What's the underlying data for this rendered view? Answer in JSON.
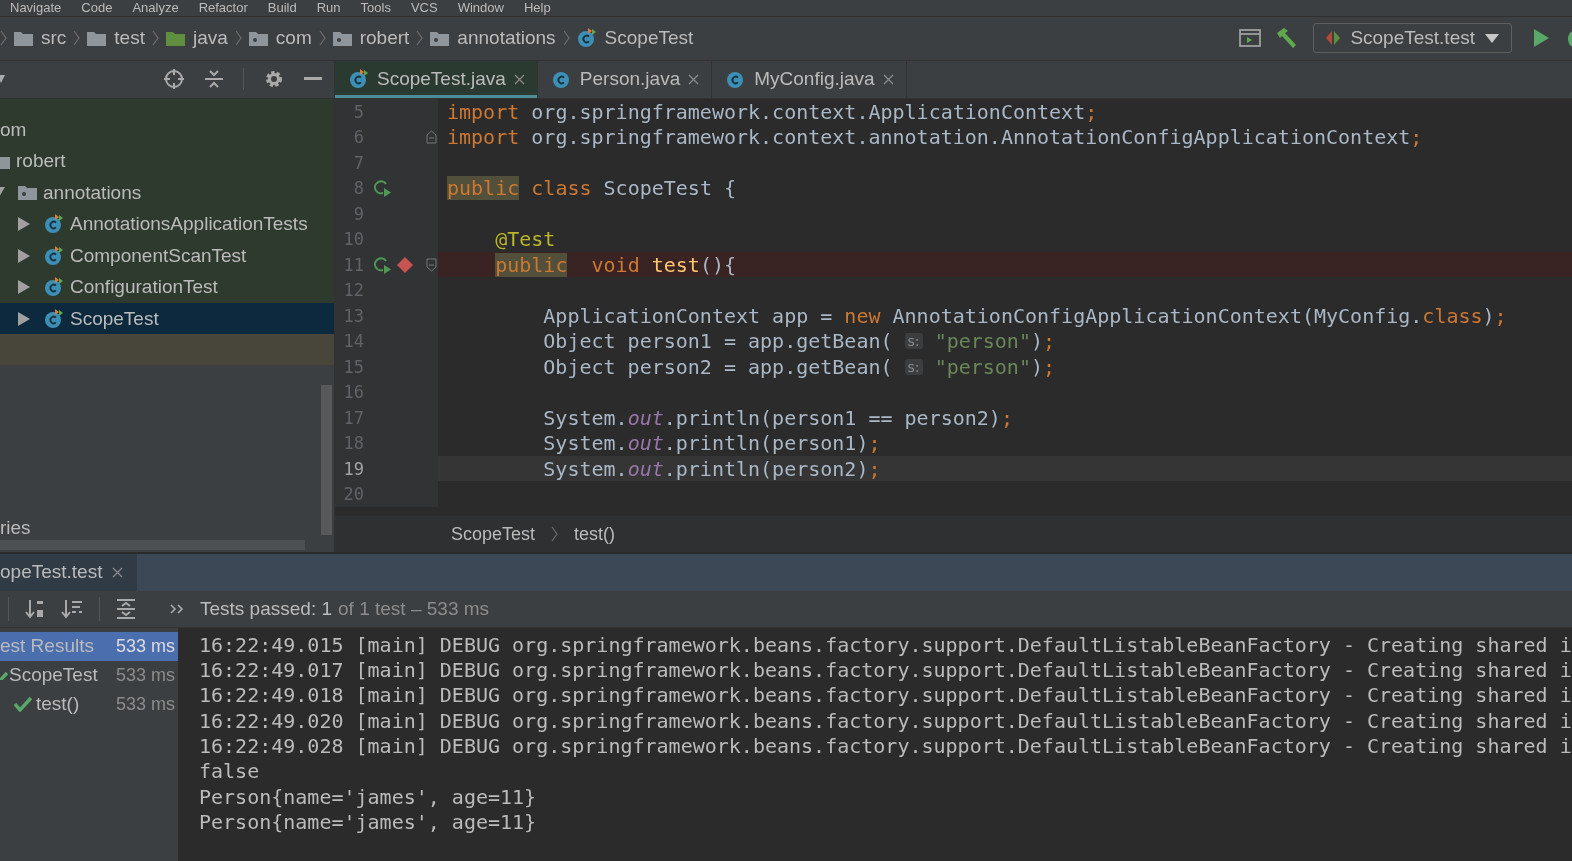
{
  "menu": [
    "Navigate",
    "Code",
    "Analyze",
    "Refactor",
    "Build",
    "Run",
    "Tools",
    "VCS",
    "Window",
    "Help"
  ],
  "breadcrumbs": [
    {
      "label": "src",
      "kind": "folder"
    },
    {
      "label": "test",
      "kind": "folder"
    },
    {
      "label": "java",
      "kind": "source_folder"
    },
    {
      "label": "com",
      "kind": "package"
    },
    {
      "label": "robert",
      "kind": "package"
    },
    {
      "label": "annotations",
      "kind": "package"
    },
    {
      "label": "ScopeTest",
      "kind": "test_class"
    }
  ],
  "run_config": {
    "label": "ScopeTest.test"
  },
  "project": {
    "tree": [
      {
        "label": "om",
        "selected": false,
        "children": [
          {
            "label": "robert",
            "kind": "package",
            "selected": false,
            "children": [
              {
                "label": "annotations",
                "kind": "package",
                "expanded": true,
                "selected": false,
                "children": [
                  {
                    "label": "AnnotationsApplicationTests",
                    "kind": "test_class",
                    "expanded": false,
                    "selected": false
                  },
                  {
                    "label": "ComponentScanTest",
                    "kind": "test_class",
                    "expanded": false,
                    "selected": false
                  },
                  {
                    "label": "ConfigurationTest",
                    "kind": "test_class",
                    "expanded": false,
                    "selected": false
                  },
                  {
                    "label": "ScopeTest",
                    "kind": "test_class",
                    "expanded": false,
                    "selected": true
                  }
                ]
              }
            ]
          }
        ]
      }
    ],
    "cut_item": "ries"
  },
  "editor": {
    "tabs": [
      {
        "label": "ScopeTest.java",
        "kind": "test_class",
        "selected": true
      },
      {
        "label": "Person.java",
        "kind": "class",
        "selected": false
      },
      {
        "label": "MyConfig.java",
        "kind": "class",
        "selected": false
      }
    ],
    "lines": [
      {
        "number": "5",
        "kind": "code",
        "run_marker": false,
        "breakpoint": false,
        "current": false,
        "tokens": [
          {
            "kind": "keyword",
            "text": "import"
          },
          {
            "kind": "plain",
            "text": " org.springframework.context.ApplicationContext"
          },
          {
            "kind": "keyword",
            "text": ";"
          }
        ]
      },
      {
        "number": "6",
        "kind": "fold_end",
        "run_marker": false,
        "breakpoint": false,
        "current": false,
        "tokens": [
          {
            "kind": "keyword",
            "text": "import"
          },
          {
            "kind": "plain",
            "text": " org.springframework.context.annotation.AnnotationConfigApplicationContext"
          },
          {
            "kind": "keyword",
            "text": ";"
          }
        ]
      },
      {
        "number": "7",
        "kind": "code",
        "run_marker": false,
        "breakpoint": false,
        "current": false
      },
      {
        "number": "8",
        "kind": "code",
        "run_marker": true,
        "breakpoint": false,
        "current": false,
        "tokens": [
          {
            "kind": "warn",
            "text": "public"
          },
          {
            "kind": "keyword",
            "text": " class"
          },
          {
            "kind": "plain",
            "text": " ScopeTest {"
          }
        ]
      },
      {
        "number": "9",
        "kind": "code",
        "run_marker": false,
        "breakpoint": false,
        "current": false
      },
      {
        "number": "10",
        "kind": "code",
        "run_marker": false,
        "breakpoint": false,
        "current": false,
        "tokens": [
          {
            "kind": "annotation",
            "text": "    @Test"
          }
        ]
      },
      {
        "number": "11",
        "kind": "fold_start",
        "run_marker": true,
        "breakpoint": true,
        "current": false,
        "tokens": [
          {
            "kind": "warn",
            "text": "    public"
          },
          {
            "kind": "keyword",
            "text": "  void"
          },
          {
            "kind": "method",
            "text": " test"
          },
          {
            "kind": "plain",
            "text": "(){"
          }
        ]
      },
      {
        "number": "12",
        "kind": "code",
        "run_marker": false,
        "breakpoint": false,
        "current": false
      },
      {
        "number": "13",
        "kind": "code",
        "run_marker": false,
        "breakpoint": false,
        "current": false,
        "tokens": [
          {
            "kind": "plain",
            "text": "        ApplicationContext app = "
          },
          {
            "kind": "keyword",
            "text": "new"
          },
          {
            "kind": "plain",
            "text": " AnnotationConfigApplicationContext(MyConfig."
          },
          {
            "kind": "keyword",
            "text": "class"
          },
          {
            "kind": "plain",
            "text": ")"
          },
          {
            "kind": "keyword",
            "text": ";"
          }
        ]
      },
      {
        "number": "14",
        "kind": "code",
        "run_marker": false,
        "breakpoint": false,
        "current": false,
        "tokens": [
          {
            "kind": "plain",
            "text": "        Object person1 = app.getBean( "
          },
          {
            "kind": "hint",
            "text": "s:"
          },
          {
            "kind": "string",
            "text": " \"person\""
          },
          {
            "kind": "plain",
            "text": ")"
          },
          {
            "kind": "keyword",
            "text": ";"
          }
        ]
      },
      {
        "number": "15",
        "kind": "code",
        "run_marker": false,
        "breakpoint": false,
        "current": false,
        "tokens": [
          {
            "kind": "plain",
            "text": "        Object person2 = app.getBean( "
          },
          {
            "kind": "hint",
            "text": "s:"
          },
          {
            "kind": "string",
            "text": " \"person\""
          },
          {
            "kind": "plain",
            "text": ")"
          },
          {
            "kind": "keyword",
            "text": ";"
          }
        ]
      },
      {
        "number": "16",
        "kind": "code",
        "run_marker": false,
        "breakpoint": false,
        "current": false
      },
      {
        "number": "17",
        "kind": "code",
        "run_marker": false,
        "breakpoint": false,
        "current": false,
        "tokens": [
          {
            "kind": "plain",
            "text": "        System."
          },
          {
            "kind": "field",
            "text": "out"
          },
          {
            "kind": "plain",
            "text": ".println(person1 == person2)"
          },
          {
            "kind": "keyword",
            "text": ";"
          }
        ]
      },
      {
        "number": "18",
        "kind": "code",
        "run_marker": false,
        "breakpoint": false,
        "current": false,
        "tokens": [
          {
            "kind": "plain",
            "text": "        System."
          },
          {
            "kind": "field",
            "text": "out"
          },
          {
            "kind": "plain",
            "text": ".println(person1)"
          },
          {
            "kind": "keyword",
            "text": ";"
          }
        ]
      },
      {
        "number": "19",
        "kind": "code",
        "run_marker": false,
        "breakpoint": false,
        "current": true,
        "tokens": [
          {
            "kind": "plain",
            "text": "        System."
          },
          {
            "kind": "field",
            "text": "out"
          },
          {
            "kind": "plain",
            "text": ".println(person2)"
          },
          {
            "kind": "keyword",
            "text": ";"
          }
        ]
      },
      {
        "number": "20",
        "kind": "code",
        "run_marker": false,
        "breakpoint": false,
        "current": false
      }
    ],
    "breadcrumbs": [
      "ScopeTest",
      "test()"
    ]
  },
  "run_panel": {
    "tab": "opeTest.test",
    "status": {
      "summary": "Tests passed: 1",
      "detail": "of 1 test – 533 ms"
    },
    "results": [
      {
        "label": "est Results",
        "time": "533 ms",
        "selected": true,
        "children": [
          {
            "label": "ScopeTest",
            "time": "533 ms",
            "selected": false,
            "passed": true,
            "children": [
              {
                "label": "test()",
                "time": "533 ms",
                "selected": false,
                "passed": true
              }
            ]
          }
        ]
      }
    ],
    "console": [
      "16:22:49.015 [main] DEBUG org.springframework.beans.factory.support.DefaultListableBeanFactory - Creating shared i",
      "16:22:49.017 [main] DEBUG org.springframework.beans.factory.support.DefaultListableBeanFactory - Creating shared i",
      "16:22:49.018 [main] DEBUG org.springframework.beans.factory.support.DefaultListableBeanFactory - Creating shared i",
      "16:22:49.020 [main] DEBUG org.springframework.beans.factory.support.DefaultListableBeanFactory - Creating shared i",
      "16:22:49.028 [main] DEBUG org.springframework.beans.factory.support.DefaultListableBeanFactory - Creating shared i",
      "false",
      "Person{name='james', age=11}",
      "Person{name='james', age=11}"
    ]
  }
}
